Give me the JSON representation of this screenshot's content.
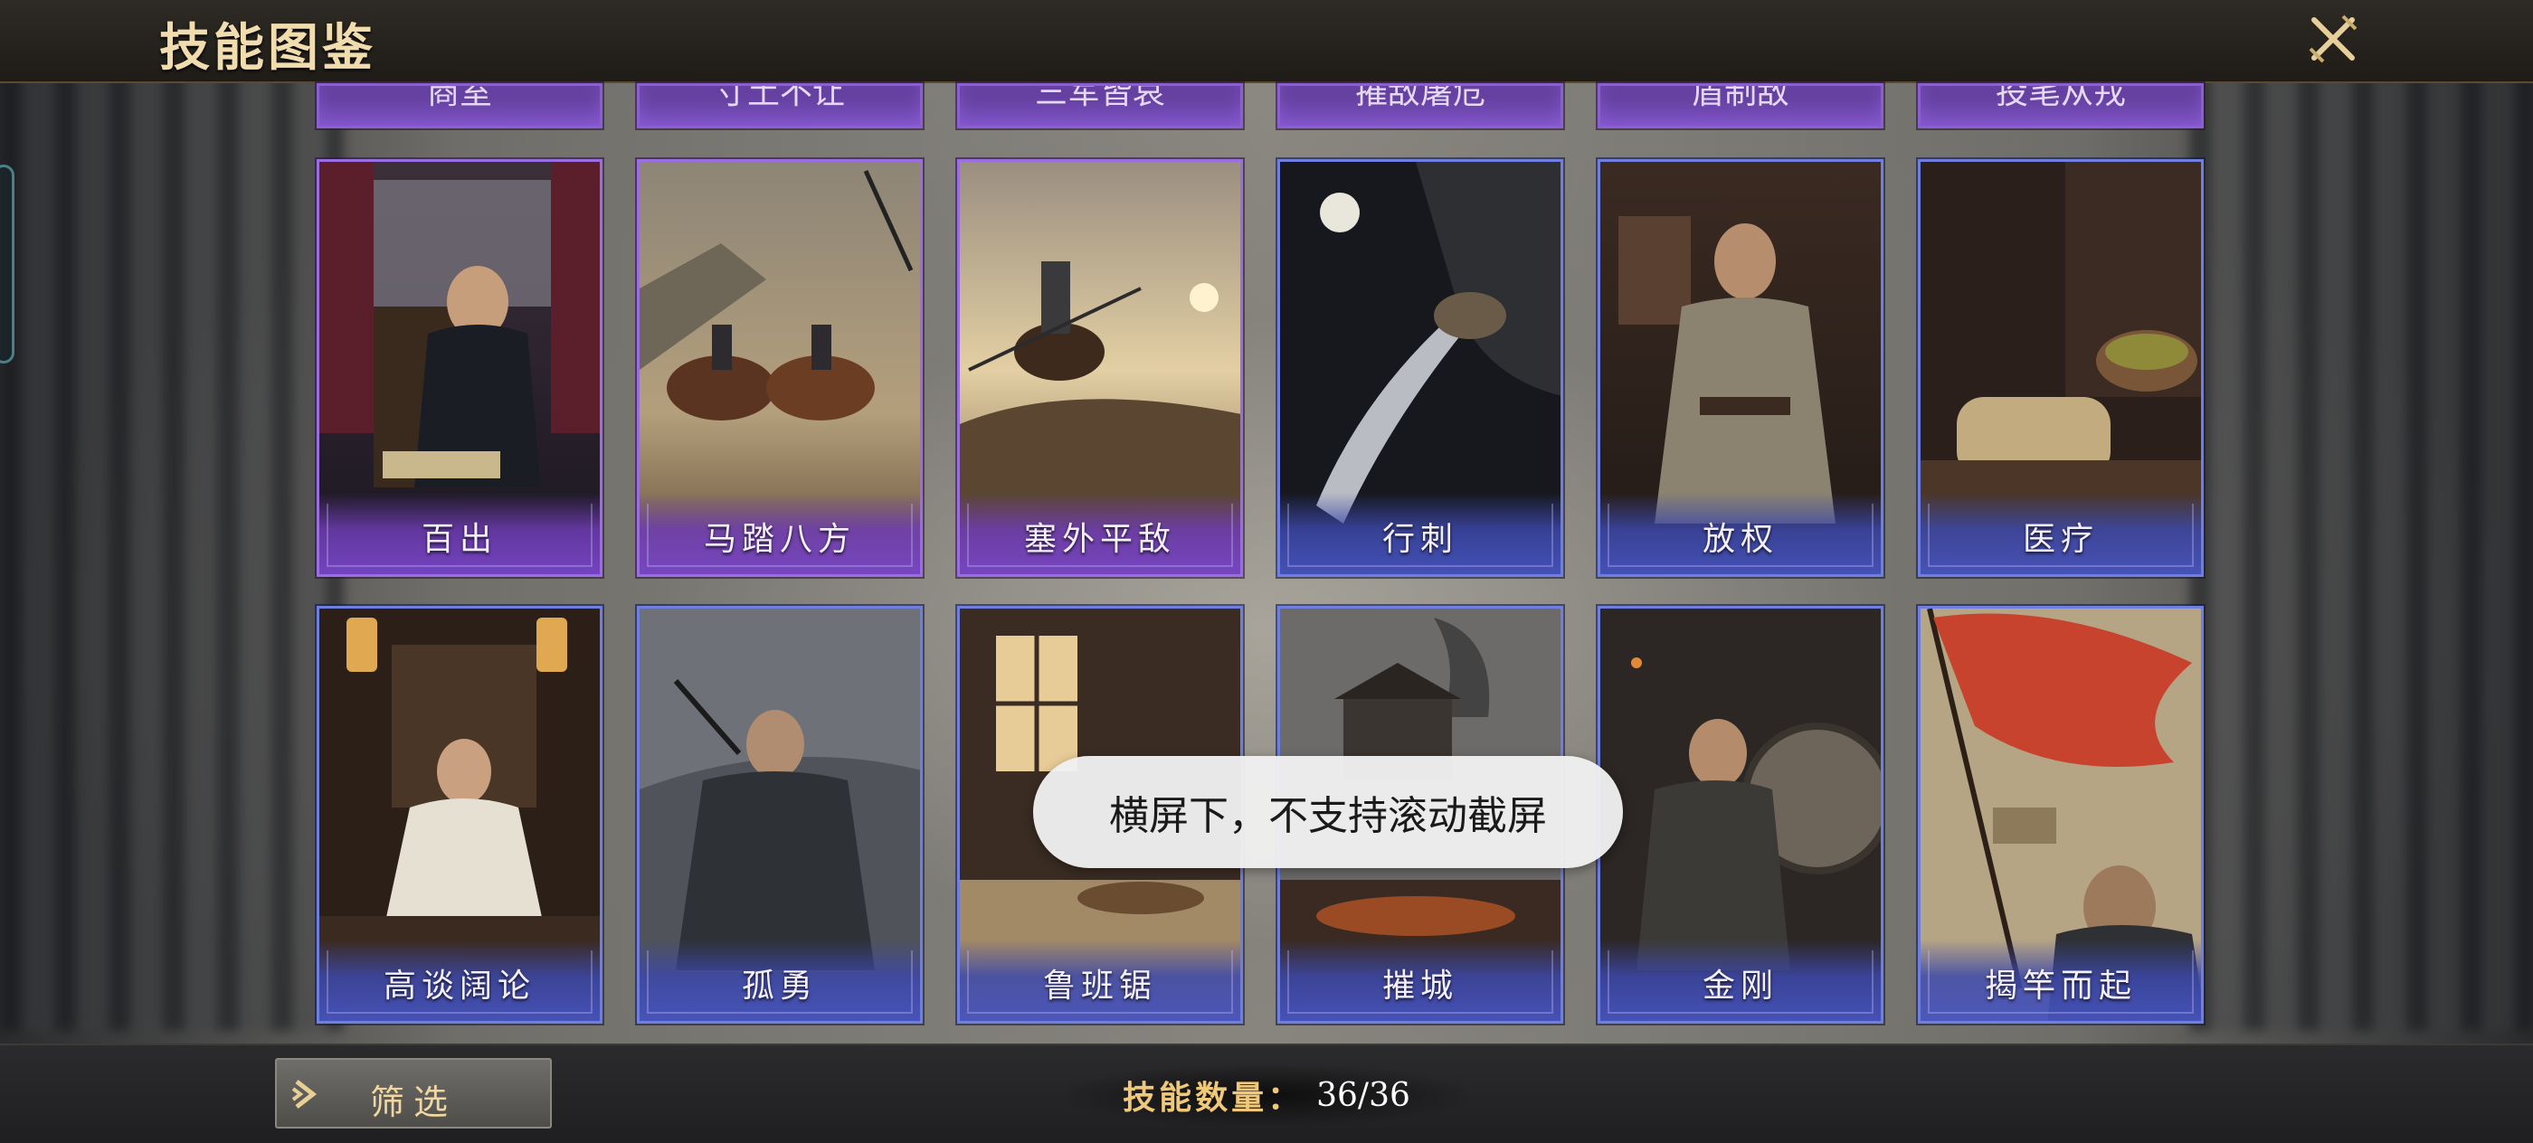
{
  "header": {
    "title": "技能图鉴"
  },
  "partial_row": [
    {
      "name": "商室"
    },
    {
      "name": "寸土不让"
    },
    {
      "name": "三军皆哀"
    },
    {
      "name": "摧敌屠危"
    },
    {
      "name": "盾制敌"
    },
    {
      "name": "投笔从戎"
    }
  ],
  "cards": [
    {
      "name": "百出",
      "rarity": "purple"
    },
    {
      "name": "马踏八方",
      "rarity": "purple"
    },
    {
      "name": "塞外平敌",
      "rarity": "purple"
    },
    {
      "name": "行刺",
      "rarity": "blue"
    },
    {
      "name": "放权",
      "rarity": "blue"
    },
    {
      "name": "医疗",
      "rarity": "blue"
    },
    {
      "name": "高谈阔论",
      "rarity": "blue"
    },
    {
      "name": "孤勇",
      "rarity": "blue"
    },
    {
      "name": "鲁班锯",
      "rarity": "blue"
    },
    {
      "name": "摧城",
      "rarity": "blue"
    },
    {
      "name": "金刚",
      "rarity": "blue"
    },
    {
      "name": "揭竿而起",
      "rarity": "blue"
    }
  ],
  "toast": {
    "text": "横屏下，不支持滚动截屏"
  },
  "footer": {
    "filter_label": "筛选",
    "count_label": "技能数量：",
    "count_value": "36/36"
  },
  "colors": {
    "title": "#f1dcae",
    "purple_border": "#9a6ee0",
    "blue_border": "#6f7fe0",
    "count_label": "#f0c87a"
  },
  "icons": {
    "close": "crossed-swords-icon",
    "filter_arrow": "arrow-right-icon"
  }
}
